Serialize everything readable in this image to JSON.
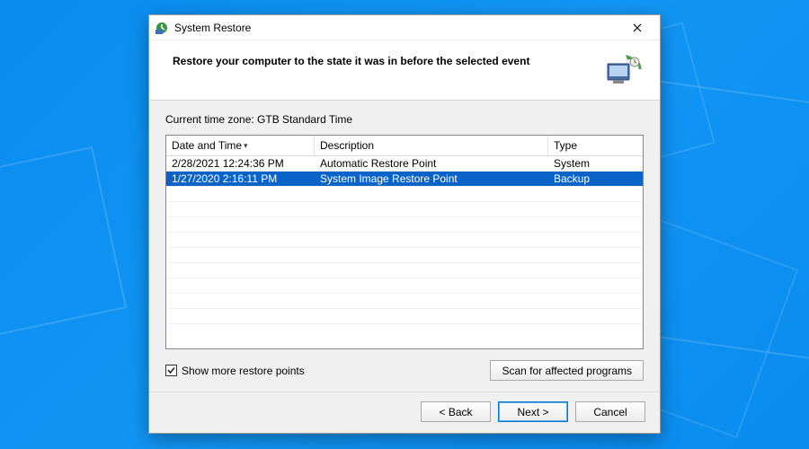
{
  "window": {
    "title": "System Restore"
  },
  "header": {
    "heading": "Restore your computer to the state it was in before the selected event"
  },
  "body": {
    "timezone_label": "Current time zone: GTB Standard Time",
    "columns": {
      "date": "Date and Time",
      "desc": "Description",
      "type": "Type"
    },
    "rows": [
      {
        "date": "2/28/2021 12:24:36 PM",
        "desc": "Automatic Restore Point",
        "type": "System",
        "selected": false
      },
      {
        "date": "1/27/2020 2:16:11 PM",
        "desc": "System Image Restore Point",
        "type": "Backup",
        "selected": true
      }
    ],
    "checkbox_label": "Show more restore points",
    "checkbox_checked": true,
    "scan_button": "Scan for affected programs"
  },
  "footer": {
    "back": "< Back",
    "next": "Next >",
    "cancel": "Cancel"
  }
}
